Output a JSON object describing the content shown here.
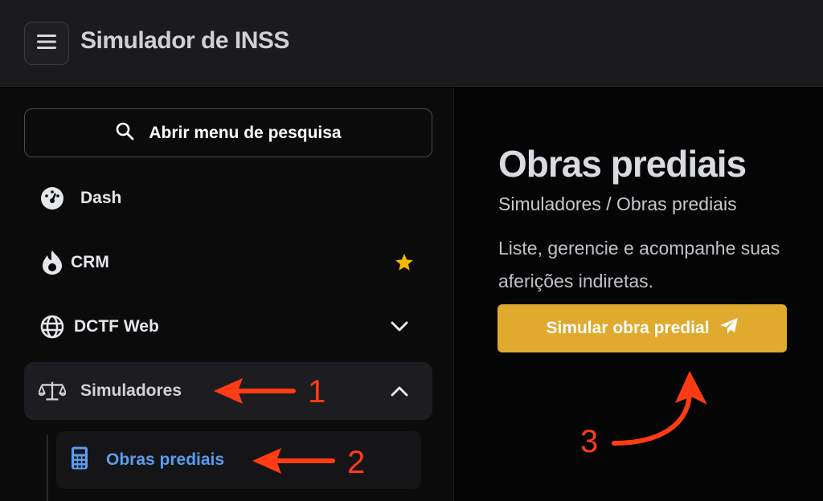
{
  "header": {
    "title": "Simulador de INSS",
    "menu_icon": "hamburger-icon"
  },
  "sidebar": {
    "search_label": "Abrir menu de pesquisa",
    "items": [
      {
        "label": "Dash",
        "icon": "dashboard-icon"
      },
      {
        "label": "CRM",
        "icon": "fire-icon",
        "badge_icon": "star-icon"
      },
      {
        "label": "DCTF Web",
        "icon": "globe-icon",
        "chevron": "chevron-down-icon"
      },
      {
        "label": "Simuladores",
        "icon": "scale-icon",
        "chevron": "chevron-up-icon",
        "active": true
      }
    ],
    "subitems": [
      {
        "label": "Obras prediais",
        "icon": "calculator-icon",
        "active": true
      }
    ]
  },
  "main": {
    "title": "Obras prediais",
    "breadcrumb": "Simuladores / Obras prediais",
    "description": "Liste, gerencie e acompanhe suas aferições indiretas.",
    "cta_label": "Simular obra predial",
    "cta_icon": "paper-plane-icon"
  },
  "annotations": {
    "step1": "1",
    "step2": "2",
    "step3": "3"
  },
  "colors": {
    "accent": "#e0aa2f",
    "active_link": "#5a9cf0",
    "annotation": "#ff3b14",
    "star": "#f5b800"
  }
}
